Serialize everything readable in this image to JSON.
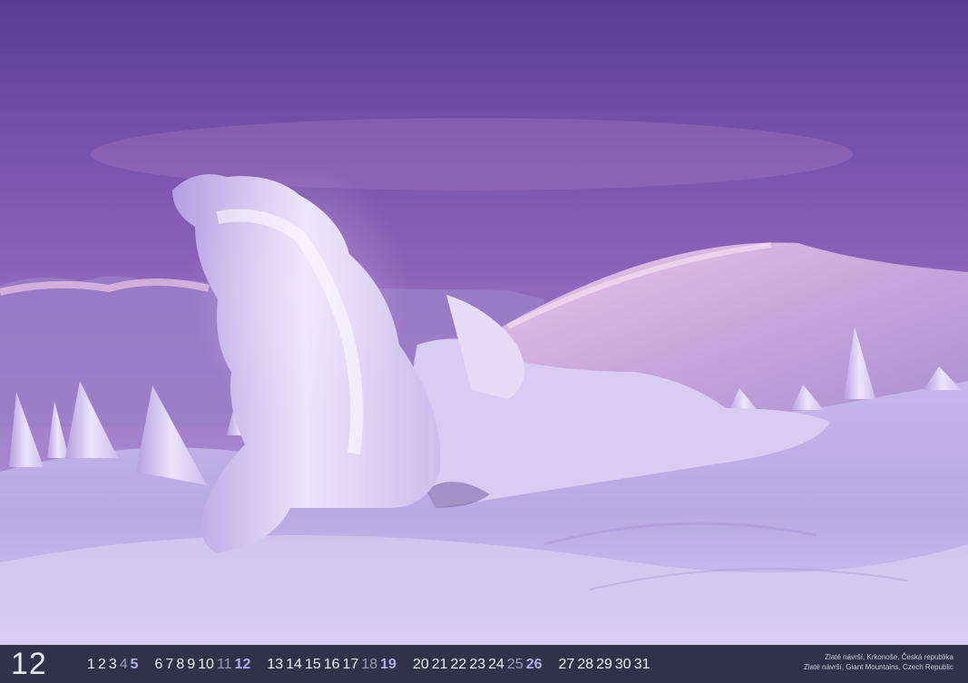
{
  "month": "12",
  "days": [
    {
      "n": "1",
      "t": "w"
    },
    {
      "n": "2",
      "t": "w"
    },
    {
      "n": "3",
      "t": "w"
    },
    {
      "n": "4",
      "t": "sat"
    },
    {
      "n": "5",
      "t": "sun"
    },
    {
      "n": "6",
      "t": "w"
    },
    {
      "n": "7",
      "t": "w"
    },
    {
      "n": "8",
      "t": "w"
    },
    {
      "n": "9",
      "t": "w"
    },
    {
      "n": "10",
      "t": "w"
    },
    {
      "n": "11",
      "t": "sat"
    },
    {
      "n": "12",
      "t": "sun"
    },
    {
      "n": "13",
      "t": "w"
    },
    {
      "n": "14",
      "t": "w"
    },
    {
      "n": "15",
      "t": "w"
    },
    {
      "n": "16",
      "t": "w"
    },
    {
      "n": "17",
      "t": "w"
    },
    {
      "n": "18",
      "t": "sat"
    },
    {
      "n": "19",
      "t": "sun"
    },
    {
      "n": "20",
      "t": "w"
    },
    {
      "n": "21",
      "t": "w"
    },
    {
      "n": "22",
      "t": "w"
    },
    {
      "n": "23",
      "t": "w"
    },
    {
      "n": "24",
      "t": "w"
    },
    {
      "n": "25",
      "t": "sat"
    },
    {
      "n": "26",
      "t": "sun"
    },
    {
      "n": "27",
      "t": "w"
    },
    {
      "n": "28",
      "t": "w"
    },
    {
      "n": "29",
      "t": "w"
    },
    {
      "n": "30",
      "t": "w"
    },
    {
      "n": "31",
      "t": "w"
    }
  ],
  "caption": {
    "line1": "Zlaté návrší, Krkonoše, Česká republika",
    "line2": "Zlaté návrší, Giant Mountains, Czech Republic"
  },
  "colors": {
    "sky_top": "#5d3f95",
    "sky_mid": "#8a5fb6",
    "snow_light": "#f4eefc",
    "snow_shadow": "#a892d4",
    "bar": "#30324a",
    "sunday": "#aeb0e8",
    "saturday": "#9a9bb6"
  }
}
